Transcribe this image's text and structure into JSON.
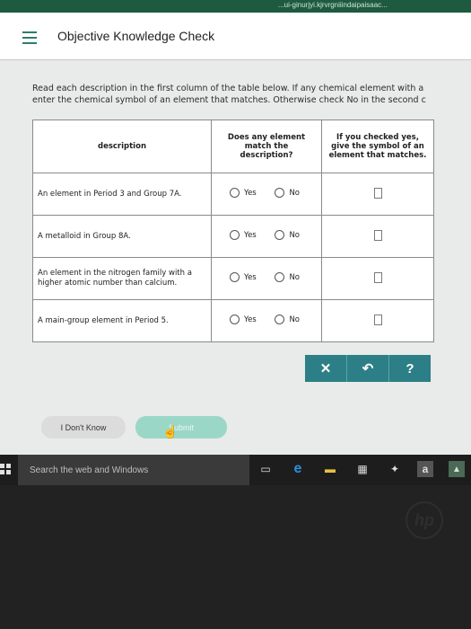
{
  "top_strip": {
    "text": "...ui-ginurjyi.kjrvrgniiindaipaisaac..."
  },
  "header": {
    "title": "Objective Knowledge Check"
  },
  "instructions": {
    "line1": "Read each description in the first column of the table below. If any chemical element with a",
    "line2": "enter the chemical symbol of an element that matches. Otherwise check No in the second c"
  },
  "table": {
    "headers": {
      "description": "description",
      "match": "Does any element match the description?",
      "symbol": "If you checked yes, give the symbol of an element that matches."
    },
    "yes_label": "Yes",
    "no_label": "No",
    "rows": [
      {
        "description": "An element in Period 3 and Group 7A."
      },
      {
        "description": "A metalloid in Group 8A."
      },
      {
        "description": "An element in the nitrogen family with a higher atomic number than calcium."
      },
      {
        "description": "A main-group element in Period 5."
      }
    ]
  },
  "actions": {
    "clear": "✕",
    "undo": "↶",
    "help": "?"
  },
  "buttons": {
    "dont_know": "I Don't Know",
    "submit": "Submit"
  },
  "taskbar": {
    "search_placeholder": "Search the web and Windows"
  },
  "icons": [
    "menu-icon",
    "windows-icon",
    "task-view-icon",
    "edge-icon",
    "file-explorer-icon",
    "store-icon",
    "dropbox-icon",
    "amazon-icon",
    "photos-icon",
    "cursor-icon",
    "hp-logo"
  ],
  "colors": {
    "accent": "#2c7f86",
    "submit": "#9bd7c7",
    "header_menu": "#2f7d6b"
  }
}
